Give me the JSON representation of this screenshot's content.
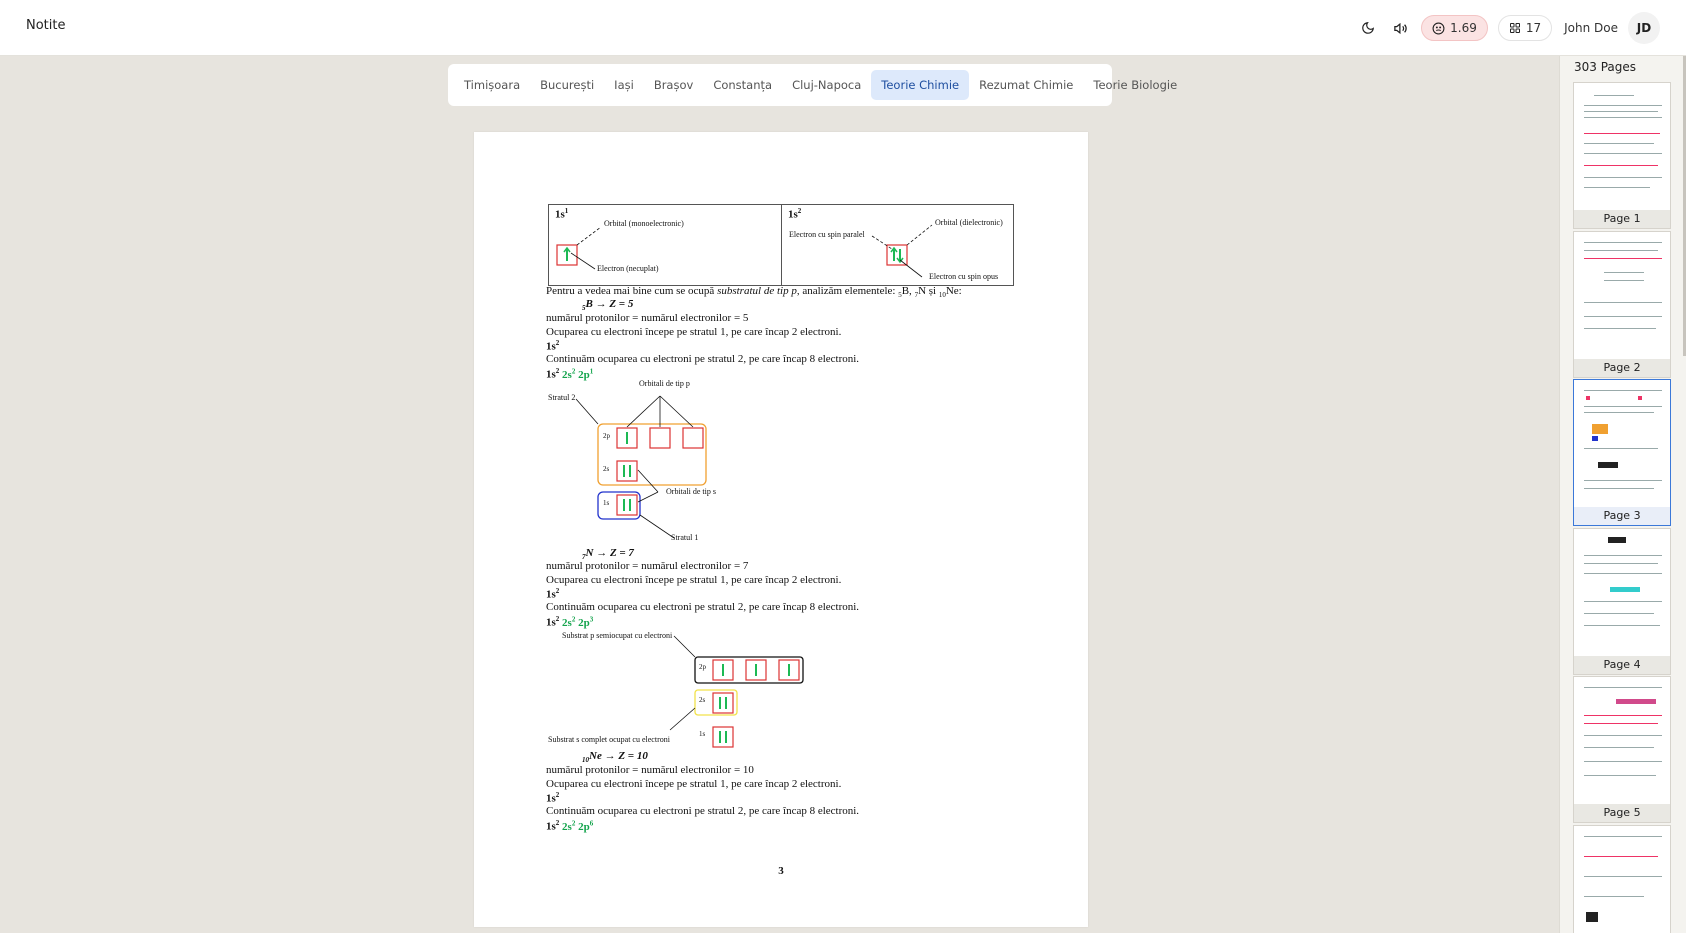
{
  "app": {
    "title": "Notite"
  },
  "header": {
    "score": "1.69",
    "count": "17",
    "user_name": "John Doe",
    "user_initials": "JD"
  },
  "tabs": [
    {
      "label": "Timișoara",
      "active": false
    },
    {
      "label": "București",
      "active": false
    },
    {
      "label": "Iași",
      "active": false
    },
    {
      "label": "Brașov",
      "active": false
    },
    {
      "label": "Constanța",
      "active": false
    },
    {
      "label": "Cluj-Napoca",
      "active": false
    },
    {
      "label": "Teorie Chimie",
      "active": true
    },
    {
      "label": "Rezumat Chimie",
      "active": false
    },
    {
      "label": "Teorie Biologie",
      "active": false
    }
  ],
  "document": {
    "table": {
      "left_head": "1s",
      "left_head_sup": "1",
      "right_head": "1s",
      "right_head_sup": "2",
      "left_orbital_label": "Orbital (monoelectronic)",
      "left_electron_label": "Electron (necuplat)",
      "right_orbital_label": "Orbital (dielectronic)",
      "right_spin_parallel": "Electron cu spin paralel",
      "right_spin_opposite": "Electron cu spin opus"
    },
    "intro_text": "Pentru a vedea mai bine cum se ocupă",
    "intro_italic": "substratul de tip p",
    "intro_tail": ", analizăm elementele:",
    "intro_elements": [
      {
        "sub": "5",
        "symbol": "B, "
      },
      {
        "sub": "7",
        "symbol": "N și "
      },
      {
        "sub": "10",
        "symbol": "Ne:"
      }
    ],
    "boron": {
      "heading_sub": "5",
      "heading": "B → Z = 5",
      "line1": "numărul protonilor = numărul electronilor = 5",
      "line2": "Ocuparea cu electroni începe pe stratul 1, pe care încap 2 electroni.",
      "config1": "1s",
      "config1_sup": "2",
      "line3": "Continuăm ocuparea cu electroni pe stratul 2, pe care încap 8 electroni.",
      "config2_a": "1s",
      "config2_a_sup": "2",
      "config2_b": "2s",
      "config2_b_sup": "2",
      "config2_c": "2p",
      "config2_c_sup": "1",
      "diagram": {
        "label_p": "Orbitali de tip p",
        "label_stratul2": "Stratul 2",
        "label_s": "Orbitali de tip s",
        "label_stratul1": "Stratul 1",
        "row_2p": "2p",
        "row_2s": "2s",
        "row_1s": "1s"
      }
    },
    "nitrogen": {
      "heading_sub": "7",
      "heading": "N → Z = 7",
      "line1": "numărul protonilor = numărul electronilor = 7",
      "line2": "Ocuparea cu electroni începe pe stratul 1, pe care încap 2 electroni.",
      "config1": "1s",
      "config1_sup": "2",
      "line3": "Continuăm ocuparea cu electroni pe stratul 2, pe care încap 8 electroni.",
      "config2_a": "1s",
      "config2_a_sup": "2",
      "config2_b": "2s",
      "config2_b_sup": "2",
      "config2_c": "2p",
      "config2_c_sup": "3",
      "diagram": {
        "label_semi": "Substrat p semiocupat cu electroni",
        "label_full": "Substrat s complet ocupat cu electroni",
        "row_2p": "2p",
        "row_2s": "2s",
        "row_1s": "1s"
      }
    },
    "neon": {
      "heading_sub": "10",
      "heading": "Ne → Z = 10",
      "line1": "numărul protonilor = numărul electronilor = 10",
      "line2": "Ocuparea cu electroni începe pe stratul 1, pe care încap 2 electroni.",
      "config1": "1s",
      "config1_sup": "2",
      "line3": "Continuăm ocuparea cu electroni pe stratul 2, pe care încap 8 electroni.",
      "config2_a": "1s",
      "config2_a_sup": "2",
      "config2_b": "2s",
      "config2_b_sup": "2",
      "config2_c": "2p",
      "config2_c_sup": "6"
    },
    "page_number": "3"
  },
  "thumbnails": {
    "count_label": "303 Pages",
    "pages": [
      {
        "label": "Page 1",
        "active": false
      },
      {
        "label": "Page 2",
        "active": false
      },
      {
        "label": "Page 3",
        "active": true
      },
      {
        "label": "Page 4",
        "active": false
      },
      {
        "label": "Page 5",
        "active": false
      },
      {
        "label": "",
        "active": false
      }
    ]
  }
}
